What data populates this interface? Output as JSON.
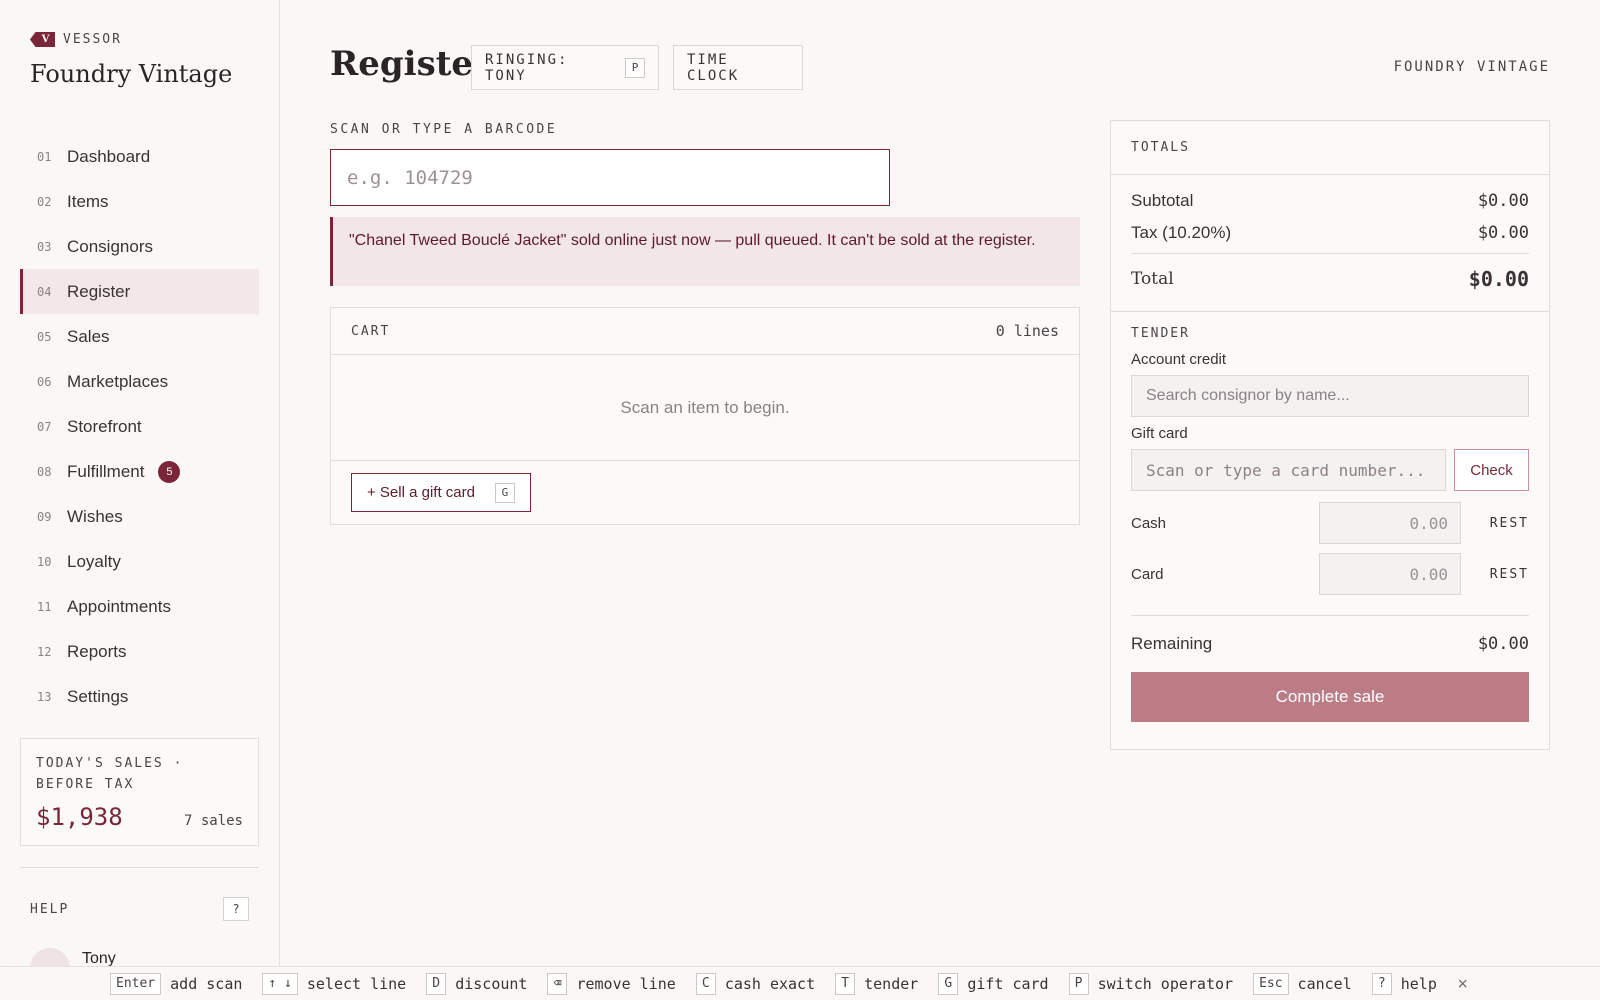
{
  "brand": {
    "name": "VESSOR",
    "logo_letter": "V"
  },
  "store_title": "Foundry Vintage",
  "nav": {
    "items": [
      {
        "num": "01",
        "label": "Dashboard"
      },
      {
        "num": "02",
        "label": "Items"
      },
      {
        "num": "03",
        "label": "Consignors"
      },
      {
        "num": "04",
        "label": "Register",
        "active": true
      },
      {
        "num": "05",
        "label": "Sales"
      },
      {
        "num": "06",
        "label": "Marketplaces"
      },
      {
        "num": "07",
        "label": "Storefront"
      },
      {
        "num": "08",
        "label": "Fulfillment",
        "badge": "5"
      },
      {
        "num": "09",
        "label": "Wishes"
      },
      {
        "num": "10",
        "label": "Loyalty"
      },
      {
        "num": "11",
        "label": "Appointments"
      },
      {
        "num": "12",
        "label": "Reports"
      },
      {
        "num": "13",
        "label": "Settings"
      }
    ]
  },
  "todays_sales": {
    "label": "TODAY'S SALES · BEFORE TAX",
    "amount": "$1,938",
    "count": "7 sales"
  },
  "help": {
    "label": "HELP",
    "key": "?"
  },
  "user": {
    "name": "Tony",
    "avatar_icon": "user-icon"
  },
  "header": {
    "title": "Register",
    "ringing_label": "RINGING: TONY",
    "ringing_key": "P",
    "time_clock_label": "TIME CLOCK",
    "shop_name": "FOUNDRY VINTAGE"
  },
  "scan": {
    "label": "SCAN OR TYPE A BARCODE",
    "placeholder": "e.g. 104729",
    "value": ""
  },
  "alert": {
    "text": "\"Chanel Tweed Bouclé Jacket\" sold online just now — pull queued. It can't be sold at the register."
  },
  "cart": {
    "title": "CART",
    "lines": "0 lines",
    "empty_text": "Scan an item to begin.",
    "gift_button": "+ Sell a gift card",
    "gift_key": "G"
  },
  "totals": {
    "title": "TOTALS",
    "subtotal_label": "Subtotal",
    "subtotal": "$0.00",
    "tax_label": "Tax (10.20%)",
    "tax": "$0.00",
    "total_label": "Total",
    "total": "$0.00"
  },
  "tender": {
    "title": "TENDER",
    "account_credit_label": "Account credit",
    "account_credit_placeholder": "Search consignor by name...",
    "gift_card_label": "Gift card",
    "gift_card_placeholder": "Scan or type a card number...",
    "check_label": "Check",
    "cash_label": "Cash",
    "cash_placeholder": "0.00",
    "card_label": "Card",
    "card_placeholder": "0.00",
    "rest_label": "REST",
    "remaining_label": "Remaining",
    "remaining": "$0.00",
    "complete_label": "Complete sale"
  },
  "shortcuts": [
    {
      "key": "Enter",
      "label": "add scan"
    },
    {
      "key": "↑ ↓",
      "label": "select line"
    },
    {
      "key": "D",
      "label": "discount"
    },
    {
      "key": "⌫",
      "label": "remove line"
    },
    {
      "key": "C",
      "label": "cash exact"
    },
    {
      "key": "T",
      "label": "tender"
    },
    {
      "key": "G",
      "label": "gift card"
    },
    {
      "key": "P",
      "label": "switch operator"
    },
    {
      "key": "Esc",
      "label": "cancel"
    },
    {
      "key": "?",
      "label": "help"
    }
  ],
  "shortcut_close": "×",
  "colors": {
    "accent": "#7b2638",
    "alert_bg": "#f3e6e8",
    "complete_button": "#bb7c86"
  }
}
